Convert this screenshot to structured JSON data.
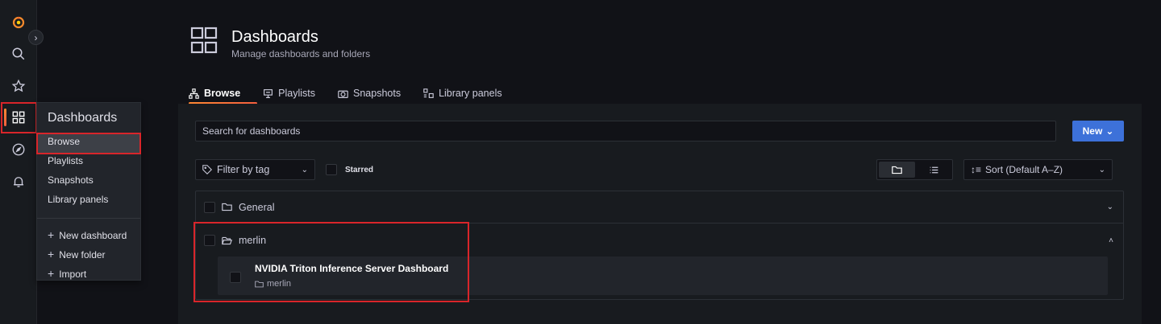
{
  "colors": {
    "accent": "#3d71d9",
    "brand_orange": "#ff8833",
    "highlight_red": "#d9252a"
  },
  "sidenav": {
    "icons": [
      "grafana-logo",
      "search-icon",
      "star-icon",
      "dashboards-icon",
      "explore-icon",
      "alert-bell-icon"
    ]
  },
  "flyout": {
    "title": "Dashboards",
    "items": [
      {
        "label": "Browse"
      },
      {
        "label": "Playlists"
      },
      {
        "label": "Snapshots"
      },
      {
        "label": "Library panels"
      }
    ],
    "actions": [
      {
        "label": "New dashboard"
      },
      {
        "label": "New folder"
      },
      {
        "label": "Import"
      }
    ]
  },
  "header": {
    "title": "Dashboards",
    "subtitle": "Manage dashboards and folders"
  },
  "tabs": [
    {
      "label": "Browse",
      "icon": "sitemap-icon"
    },
    {
      "label": "Playlists",
      "icon": "presentation-icon"
    },
    {
      "label": "Snapshots",
      "icon": "camera-icon"
    },
    {
      "label": "Library panels",
      "icon": "library-panel-icon"
    }
  ],
  "toolbar": {
    "search_placeholder": "Search for dashboards",
    "new_label": "New",
    "filter_label": "Filter by tag",
    "starred_label": "Starred",
    "sort_label": "Sort (Default A–Z)"
  },
  "folders": [
    {
      "name": "General"
    },
    {
      "name": "merlin"
    }
  ],
  "dashboard_item": {
    "title": "NVIDIA Triton Inference Server Dashboard",
    "folder": "merlin"
  }
}
